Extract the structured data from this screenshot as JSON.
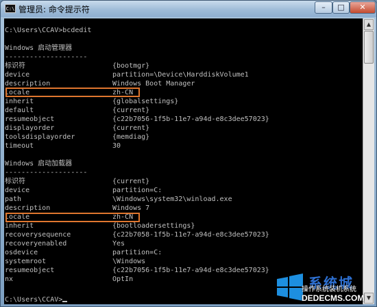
{
  "window": {
    "title": "管理员: 命令提示符",
    "icon_text": "C:\\",
    "min_glyph": "–",
    "max_glyph": "□",
    "close_glyph": "✕"
  },
  "console": {
    "prompt_command": "C:\\Users\\CCAV>bcdedit",
    "section1_title": "Windows 启动管理器",
    "section2_title": "Windows 启动加载器",
    "separator": "--------------------",
    "final_prompt": "C:\\Users\\CCAV>",
    "boot_manager": [
      {
        "key": "标识符",
        "value": "{bootmgr}"
      },
      {
        "key": "device",
        "value": "partition=\\Device\\HarddiskVolume1"
      },
      {
        "key": "description",
        "value": "Windows Boot Manager"
      },
      {
        "key": "locale",
        "value": "zh-CN"
      },
      {
        "key": "inherit",
        "value": "{globalsettings}"
      },
      {
        "key": "default",
        "value": "{current}"
      },
      {
        "key": "resumeobject",
        "value": "{c22b7056-1f5b-11e7-a94d-e8c3dee57023}"
      },
      {
        "key": "displayorder",
        "value": "{current}"
      },
      {
        "key": "toolsdisplayorder",
        "value": "{memdiag}"
      },
      {
        "key": "timeout",
        "value": "30"
      }
    ],
    "boot_loader": [
      {
        "key": "标识符",
        "value": "{current}"
      },
      {
        "key": "device",
        "value": "partition=C:"
      },
      {
        "key": "path",
        "value": "\\Windows\\system32\\winload.exe"
      },
      {
        "key": "description",
        "value": "Windows 7"
      },
      {
        "key": "locale",
        "value": "zh-CN"
      },
      {
        "key": "inherit",
        "value": "{bootloadersettings}"
      },
      {
        "key": "recoverysequence",
        "value": "{c22b7058-1f5b-11e7-a94d-e8c3dee57023}"
      },
      {
        "key": "recoveryenabled",
        "value": "Yes"
      },
      {
        "key": "osdevice",
        "value": "partition=C:"
      },
      {
        "key": "systemroot",
        "value": "\\Windows"
      },
      {
        "key": "resumeobject",
        "value": "{c22b7056-1f5b-11e7-a94d-e8c3dee57023}"
      },
      {
        "key": "nx",
        "value": "OptIn"
      }
    ]
  },
  "scrollbar": {
    "up_glyph": "▲",
    "down_glyph": "▼"
  },
  "watermark": {
    "title": "系统城",
    "subtitle": "操作系统装机系统",
    "domain": "DEDECMS.COM"
  },
  "colors": {
    "console_bg": "#000000",
    "console_text": "#c0c0c0",
    "highlight": "#e0772f"
  }
}
